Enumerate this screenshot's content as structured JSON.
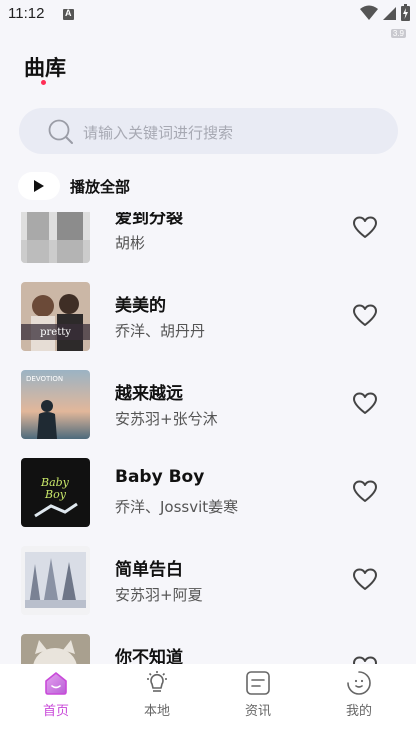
{
  "status_bar": {
    "time": "11:12",
    "network_badge": "3.9"
  },
  "header": {
    "title": "曲库"
  },
  "search": {
    "placeholder": "请输入关键词进行搜索"
  },
  "play_all": {
    "label": "播放全部"
  },
  "songs": [
    {
      "title": "爱到分裂",
      "artist": "胡彬",
      "cover": "grayscale-couple"
    },
    {
      "title": "美美的",
      "artist": "乔洋、胡丹丹",
      "cover": "pretty"
    },
    {
      "title": "越来越远",
      "artist": "安苏羽+张兮沐",
      "cover": "devotion"
    },
    {
      "title": "Baby Boy",
      "artist": "乔洋、Jossvit姜寒",
      "cover": "baby-boy"
    },
    {
      "title": "简单告白",
      "artist": "安苏羽+阿夏",
      "cover": "winter-trees"
    },
    {
      "title": "你不知道",
      "artist": "",
      "cover": "cat"
    }
  ],
  "tabs": [
    {
      "label": "首页",
      "icon": "home-icon",
      "active": true
    },
    {
      "label": "本地",
      "icon": "lightbulb-icon",
      "active": false
    },
    {
      "label": "资讯",
      "icon": "news-icon",
      "active": false
    },
    {
      "label": "我的",
      "icon": "face-icon",
      "active": false
    }
  ],
  "colors": {
    "accent": "#c94ad9",
    "dot": "#ff2d55",
    "search_bg": "#e9ebf4"
  }
}
